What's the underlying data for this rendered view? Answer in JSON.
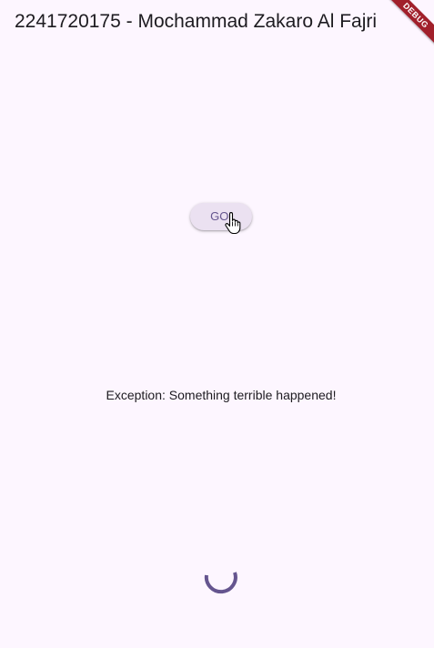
{
  "app_bar": {
    "title": "2241720175 - Mochammad Zakaro Al Fajri"
  },
  "debug_banner": {
    "label": "DEBUG"
  },
  "main": {
    "go_button_label": "GO!",
    "error_message": "Exception: Something terrible happened!"
  },
  "colors": {
    "background": "#fdf6ff",
    "primary": "#65558f",
    "button_bg": "#ebe1f1",
    "debug_banner": "#a1202b"
  },
  "icons": {
    "cursor": "hand-pointer-cursor-icon",
    "spinner": "loading-spinner-icon"
  }
}
